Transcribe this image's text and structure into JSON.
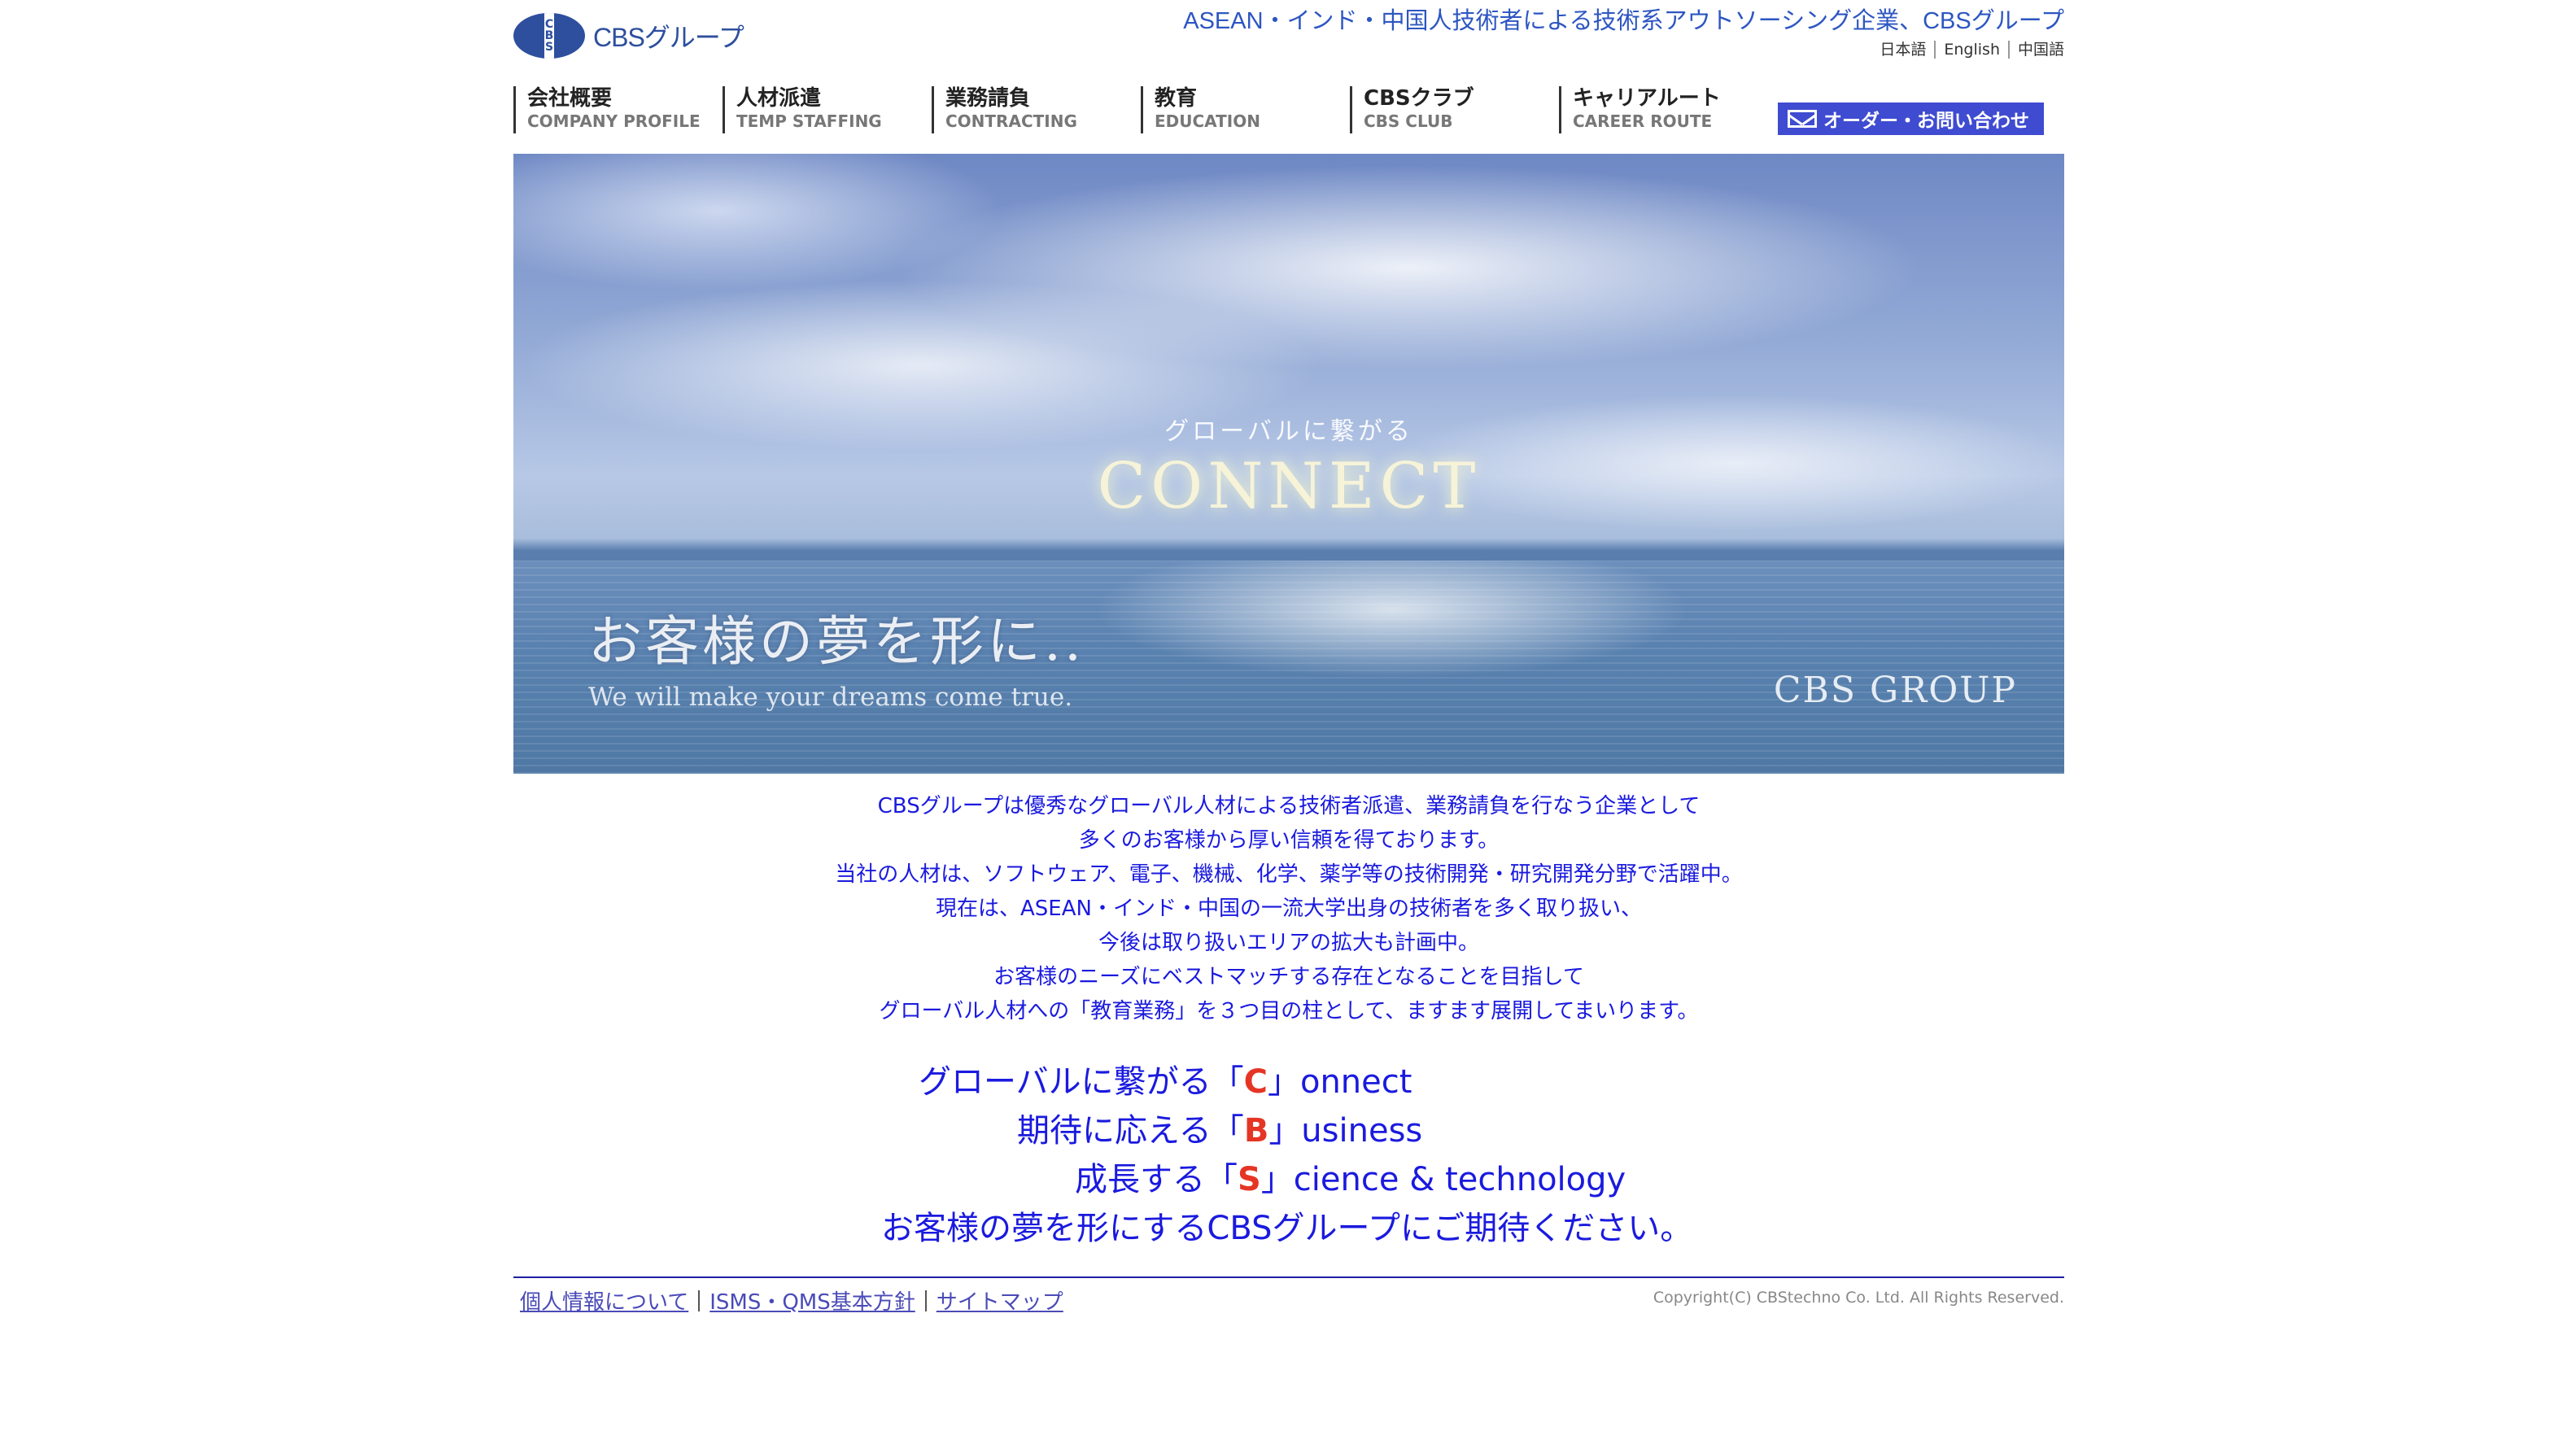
{
  "header": {
    "logo_text": "CBSグループ",
    "logo_mark": "CBS",
    "tagline": "ASEAN・インド・中国人技術者による技術系アウトソーシング企業、CBSグループ",
    "languages": [
      "日本語",
      "English",
      "中国語"
    ]
  },
  "nav": {
    "items": [
      {
        "jp": "会社概要",
        "en": "COMPANY PROFILE"
      },
      {
        "jp": "人材派遣",
        "en": "TEMP STAFFING"
      },
      {
        "jp": "業務請負",
        "en": "CONTRACTING"
      },
      {
        "jp": "教育",
        "en": "EDUCATION"
      },
      {
        "jp": "CBSクラブ",
        "en": "CBS CLUB"
      },
      {
        "jp": "キャリアルート",
        "en": "CAREER ROUTE"
      }
    ],
    "contact_label": "オーダー・お問い合わせ",
    "contact_icon": "mail-icon"
  },
  "hero": {
    "subtitle": "グローバルに繋がる",
    "title": "CONNECT",
    "main_text": "お客様の夢を形に..",
    "english_text": "We will make your dreams come true.",
    "group_label": "CBS GROUP"
  },
  "intro": {
    "lines": [
      "CBSグループは優秀なグローバル人材による技術者派遣、業務請負を行なう企業として",
      "多くのお客様から厚い信頼を得ております。",
      "当社の人材は、ソフトウェア、電子、機械、化学、薬学等の技術開発・研究開発分野で活躍中。",
      "現在は、ASEAN・インド・中国の一流大学出身の技術者を多く取り扱い、",
      "今後は取り扱いエリアの拡大も計画中。",
      "お客様のニーズにベストマッチする存在となることを目指して",
      "グローバル人材への「教育業務」を３つ目の柱として、ますます展開してまいります。"
    ]
  },
  "cbs": {
    "line1": {
      "prefix": "グローバルに繋がる「",
      "letter": "C",
      "suffix": "」onnect"
    },
    "line2": {
      "prefix": "期待に応える「",
      "letter": "B",
      "suffix": "」usiness"
    },
    "line3": {
      "prefix": "成長する「",
      "letter": "S",
      "suffix": "」cience & technology"
    },
    "line4": "お客様の夢を形にするCBSグループにご期待ください。"
  },
  "footer": {
    "links": [
      "個人情報について",
      "ISMS・QMS基本方針",
      "サイトマップ"
    ],
    "copyright": "Copyright(C) CBStechno Co. Ltd. All Rights Reserved."
  },
  "colors": {
    "accent_blue": "#1a1adf",
    "highlight_red": "#e53525",
    "contact_button": "#3f4bd0",
    "logo_blue": "#2d4f9e"
  }
}
